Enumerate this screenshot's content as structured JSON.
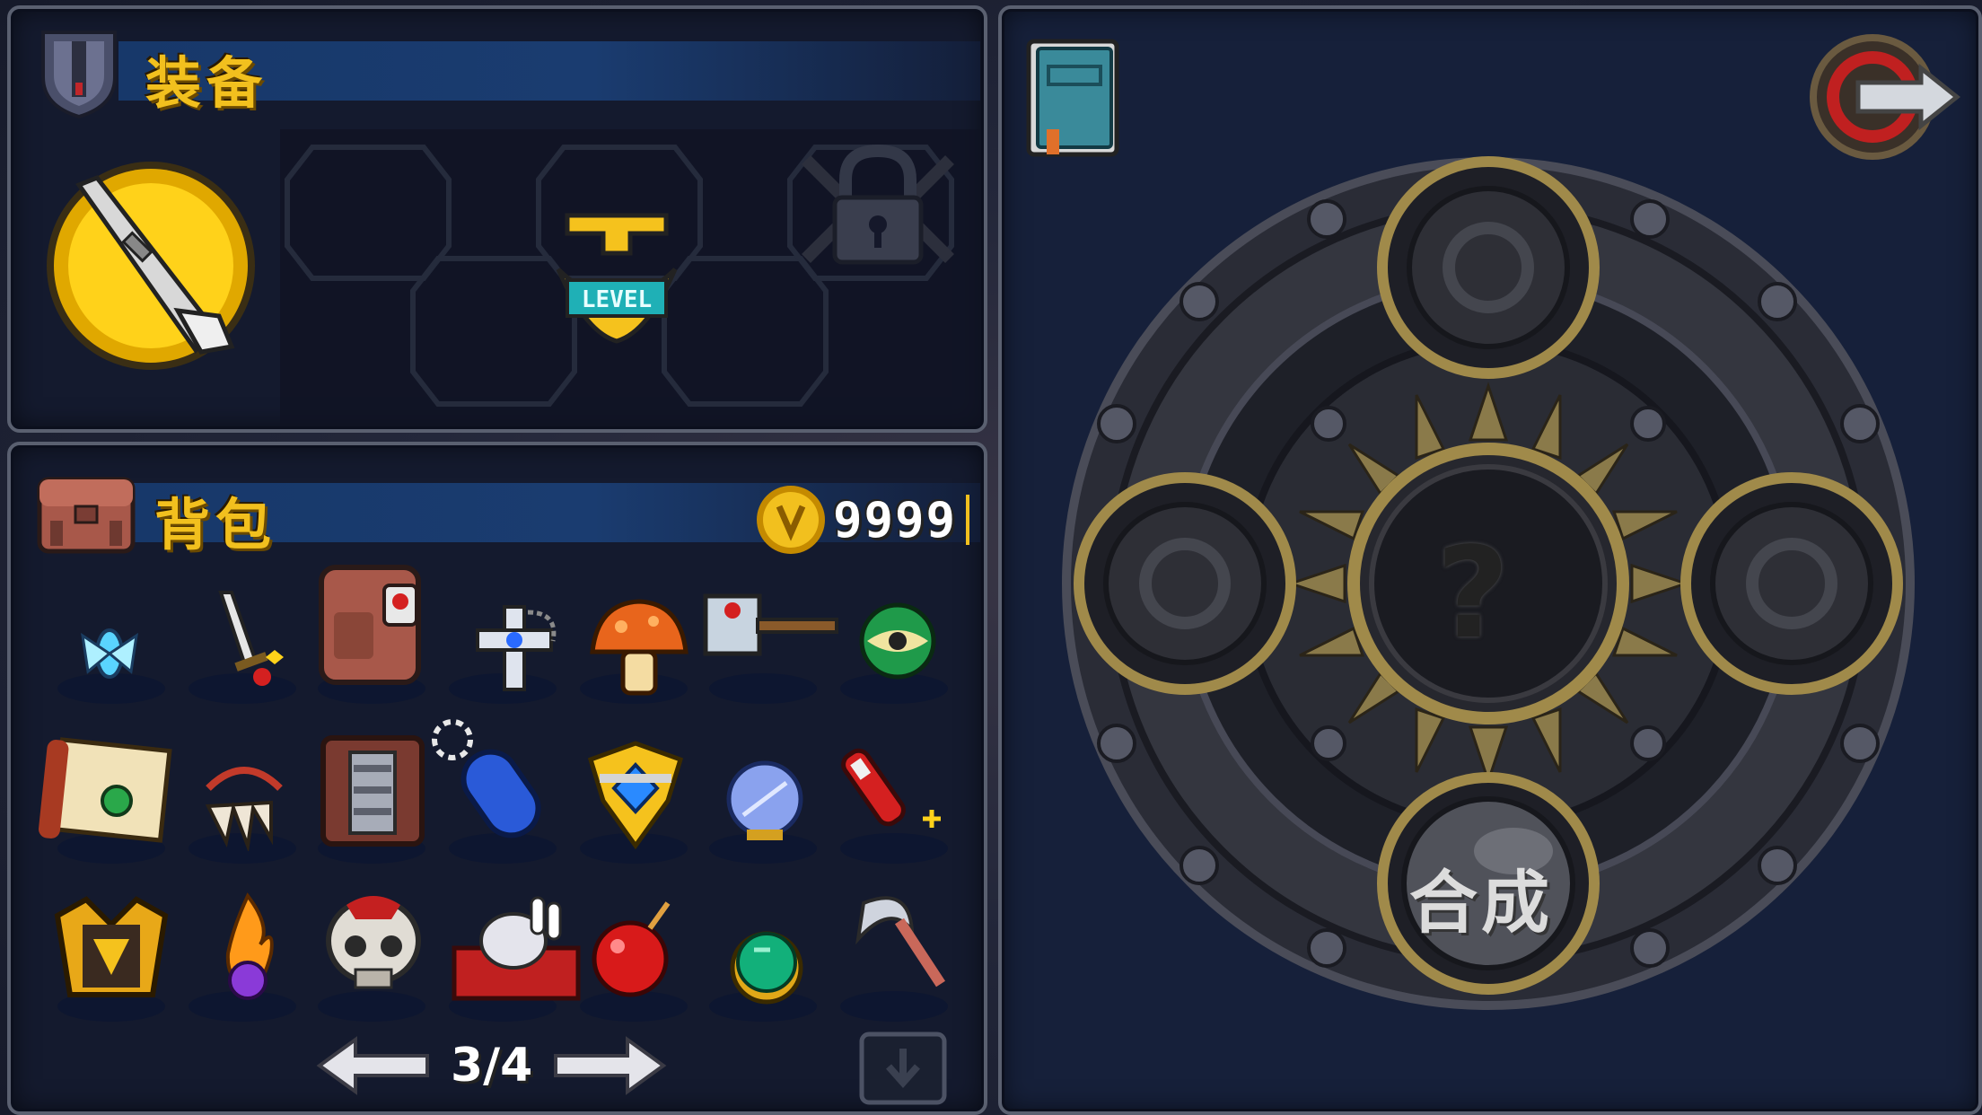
{
  "equipment": {
    "title": "装备",
    "weapon_icon": "rifle-icon",
    "upgrade_badge": "LEVEL",
    "locked_slot_icon": "padlock-icon"
  },
  "backpack": {
    "title": "背包",
    "gold": "9999",
    "page": "3/4",
    "items": [
      "fairy-icon",
      "sword-icon",
      "backpack-icon",
      "cross-icon",
      "mushroom-icon",
      "hammer-icon",
      "orb-icon",
      "scroll-icon",
      "claw-icon",
      "armor-icon",
      "dogtag-icon",
      "crest-icon",
      "crystal-ball-icon",
      "rocket-icon",
      "helmet-icon",
      "flame-potion-icon",
      "skull-icon",
      "rabbit-icon",
      "bomb-icon",
      "emerald-ring-icon",
      "sickle-icon"
    ]
  },
  "crafting": {
    "combine_label": "合成",
    "result_placeholder": "?"
  },
  "colors": {
    "title_gold": "#f2c01e",
    "header_blue": "#17386a",
    "panel_bg": "#141a2e"
  }
}
